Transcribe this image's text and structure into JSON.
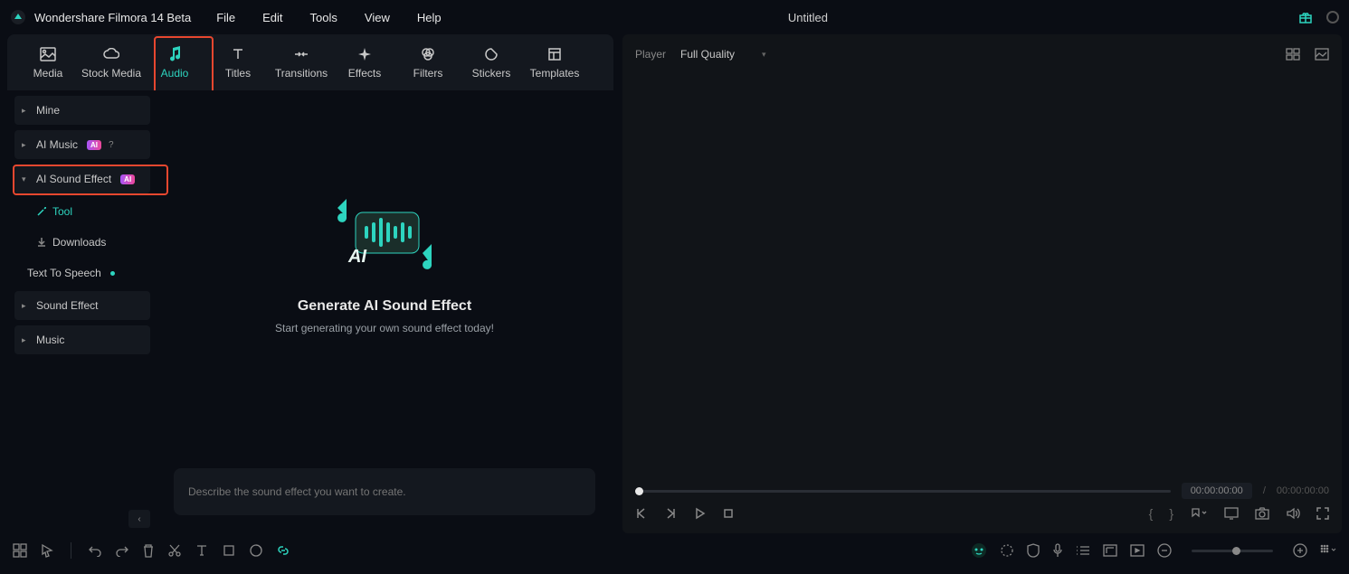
{
  "app": {
    "title": "Wondershare Filmora 14 Beta",
    "doc_title": "Untitled"
  },
  "menu": {
    "file": "File",
    "edit": "Edit",
    "tools": "Tools",
    "view": "View",
    "help": "Help"
  },
  "tabs": {
    "media": "Media",
    "stock": "Stock Media",
    "audio": "Audio",
    "titles": "Titles",
    "transitions": "Transitions",
    "effects": "Effects",
    "filters": "Filters",
    "stickers": "Stickers",
    "templates": "Templates"
  },
  "sidebar": {
    "mine": "Mine",
    "ai_music": "AI Music",
    "ai_sound_effect": "AI Sound Effect",
    "tool": "Tool",
    "downloads": "Downloads",
    "tts": "Text To Speech",
    "sound_effect": "Sound Effect",
    "music": "Music",
    "ai_badge": "AI"
  },
  "content": {
    "title": "Generate AI Sound Effect",
    "subtitle": "Start generating your own sound effect today!",
    "placeholder": "Describe the sound effect you want to create."
  },
  "player": {
    "label": "Player",
    "quality": "Full Quality",
    "time_current": "00:00:00:00",
    "time_sep": "/",
    "time_total": "00:00:00:00"
  },
  "colors": {
    "accent": "#2dd4bf",
    "highlight": "#e7472f"
  }
}
